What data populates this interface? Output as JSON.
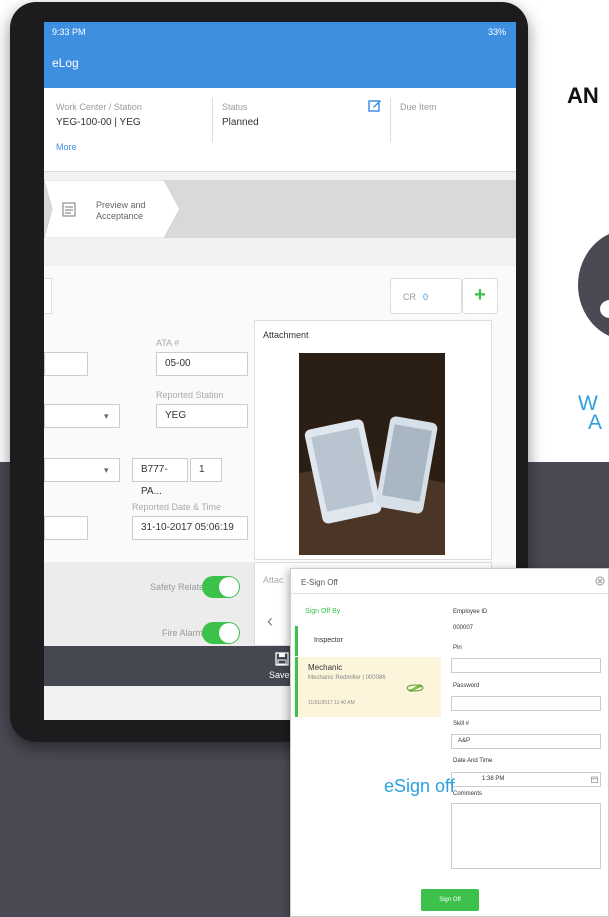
{
  "slide": {
    "heading": "AN",
    "caption_line1": "W",
    "caption_line2": "A",
    "esign_caption": "eSign off"
  },
  "status_bar": {
    "time": "9:33 PM",
    "battery": "33%"
  },
  "app": {
    "title": "eLog"
  },
  "info": {
    "work_center_label": "Work Center / Station",
    "work_center_value": "YEG-100-00 | YEG",
    "status_label": "Status",
    "status_value": "Planned",
    "due_item_label": "Due Item",
    "more_link": "More"
  },
  "steps": {
    "preview_line1": "Preview and",
    "preview_line2": "Acceptance"
  },
  "counter": {
    "label": "CR",
    "value": "0"
  },
  "form": {
    "ata_label": "ATA #",
    "ata_value": "05-00",
    "reported_station_label": "Reported Station",
    "reported_station_value": "YEG",
    "part_value": "B777-PA...",
    "part_qty": "1",
    "reported_datetime_label": "Reported Date & Time",
    "reported_datetime_value": "31-10-2017 05:06:19"
  },
  "attachment": {
    "title": "Attachment",
    "lower_label": "Attac"
  },
  "toggles": {
    "safety_related": "Safety Related",
    "fire_alarm": "Fire Alarm?"
  },
  "bottom_bar": {
    "save_label": "Save"
  },
  "esign": {
    "title": "E-Sign Off",
    "sign_off_by": "Sign Off By",
    "inspector": "Inspector",
    "mechanic_title": "Mechanic",
    "mechanic_sub": "Mechanic Redmiller | 000086",
    "mechanic_meta": "11/01/2017 11:40 AM",
    "employee_id_label": "Employee ID",
    "employee_id_value": "000007",
    "pin_label": "Pin",
    "password_label": "Password",
    "skill_label": "Skill #",
    "skill_value": "A&P",
    "date_time_label": "Date And Time",
    "date_time_value": "1:38 PM",
    "comments_label": "Comments",
    "signoff_button": "Sign Off"
  },
  "colors": {
    "app_blue": "#3f8fe0",
    "accent_green": "#3cc24a",
    "dark_band": "#4a4a54",
    "caption_blue": "#2ba0de"
  }
}
